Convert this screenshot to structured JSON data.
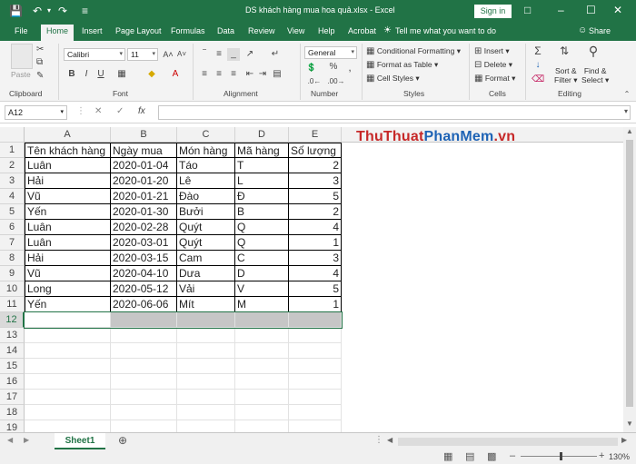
{
  "titlebar": {
    "title": "DS khách hàng mua hoa quả.xlsx  -  Excel",
    "signin": "Sign in"
  },
  "tabs": [
    "File",
    "Home",
    "Insert",
    "Page Layout",
    "Formulas",
    "Data",
    "Review",
    "View",
    "Help",
    "Acrobat"
  ],
  "active_tab": "Home",
  "tellme": "Tell me what you want to do",
  "share": "Share",
  "ribbon": {
    "clipboard": {
      "paste": "Paste",
      "label": "Clipboard"
    },
    "font": {
      "name": "Calibri",
      "size": "11",
      "label": "Font"
    },
    "alignment": {
      "label": "Alignment"
    },
    "number": {
      "format": "General",
      "label": "Number"
    },
    "styles": {
      "conditional": "Conditional Formatting",
      "table": "Format as Table",
      "cellstyles": "Cell Styles",
      "label": "Styles"
    },
    "cells": {
      "insert": "Insert",
      "delete": "Delete",
      "format": "Format",
      "label": "Cells"
    },
    "editing": {
      "sort": "Sort &",
      "filter": "Filter",
      "find": "Find &",
      "select": "Select",
      "label": "Editing"
    }
  },
  "namebox": "A12",
  "watermark": {
    "part1": "ThuThuat",
    "part2": "PhanMem",
    "part3": ".vn"
  },
  "columns": [
    "A",
    "B",
    "C",
    "D",
    "E"
  ],
  "rows": [
    "1",
    "2",
    "3",
    "4",
    "5",
    "6",
    "7",
    "8",
    "9",
    "10",
    "11",
    "12",
    "13",
    "14",
    "15",
    "16",
    "17",
    "18",
    "19"
  ],
  "headers": [
    "Tên khách hàng",
    "Ngày mua",
    "Món hàng",
    "Mã hàng",
    "Số lượng"
  ],
  "data": [
    [
      "Luân",
      "2020-01-04",
      "Táo",
      "T",
      "2"
    ],
    [
      "Hải",
      "2020-01-20",
      "Lê",
      "L",
      "3"
    ],
    [
      "Vũ",
      "2020-01-21",
      "Đào",
      "Đ",
      "5"
    ],
    [
      "Yến",
      "2020-01-30",
      "Bưởi",
      "B",
      "2"
    ],
    [
      "Luân",
      "2020-02-28",
      "Quýt",
      "Q",
      "4"
    ],
    [
      "Luân",
      "2020-03-01",
      "Quýt",
      "Q",
      "1"
    ],
    [
      "Hải",
      "2020-03-15",
      "Cam",
      "C",
      "3"
    ],
    [
      "Vũ",
      "2020-04-10",
      "Dưa",
      "D",
      "4"
    ],
    [
      "Long",
      "2020-05-12",
      "Vải",
      "V",
      "5"
    ],
    [
      "Yến",
      "2020-06-06",
      "Mít",
      "M",
      "1"
    ]
  ],
  "sheet": "Sheet1",
  "zoom": "130%",
  "colors": {
    "accent": "#217346",
    "selection": "#c6c6c6"
  }
}
